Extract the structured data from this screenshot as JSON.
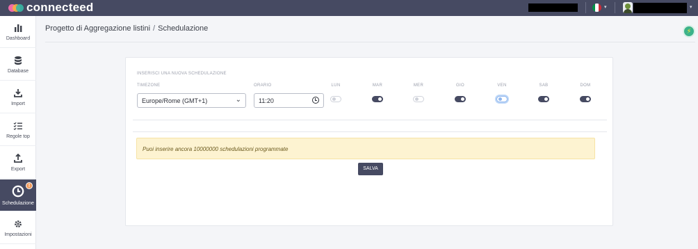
{
  "app": {
    "logo_text": "connecteed"
  },
  "topbar": {
    "language_flag_colors": [
      "#009246",
      "#ffffff",
      "#ce2b37"
    ],
    "language_caret": "▾",
    "user_caret": "▾"
  },
  "sidebar": {
    "items": [
      {
        "label": "Dashboard",
        "icon": "bar-chart-icon"
      },
      {
        "label": "Database",
        "icon": "database-icon"
      },
      {
        "label": "Import",
        "icon": "import-icon"
      },
      {
        "label": "Regole top",
        "icon": "checklist-icon"
      },
      {
        "label": "Export",
        "icon": "export-icon"
      },
      {
        "label": "Schedulazione",
        "icon": "clock-icon",
        "active": true,
        "badge": "!"
      },
      {
        "label": "Impostazioni",
        "icon": "gear-icon"
      }
    ]
  },
  "breadcrumb": {
    "project": "Progetto di Aggregazione listini",
    "separator": "/",
    "current": "Schedulazione"
  },
  "form": {
    "section_title": "INSERISCI UNA NUOVA SCHEDULAZIONE",
    "timezone_label": "TIMEZONE",
    "timezone_value": "Europe/Rome (GMT+1)",
    "time_label": "ORARIO",
    "time_value": "11:20",
    "days": [
      {
        "label": "LUN",
        "state": "off"
      },
      {
        "label": "MAR",
        "state": "on"
      },
      {
        "label": "MER",
        "state": "off"
      },
      {
        "label": "GIO",
        "state": "on"
      },
      {
        "label": "VEN",
        "state": "focus"
      },
      {
        "label": "SAB",
        "state": "on"
      },
      {
        "label": "DOM",
        "state": "on"
      }
    ],
    "alert_text": "Puoi inserire ancora 10000000 schedulazioni programmate",
    "save_label": "SALVA"
  },
  "colors": {
    "primary": "#464a62",
    "alert_bg": "#fdf3d1",
    "bolt_bg": "#3cb28a",
    "badge": "#f29a5a"
  }
}
